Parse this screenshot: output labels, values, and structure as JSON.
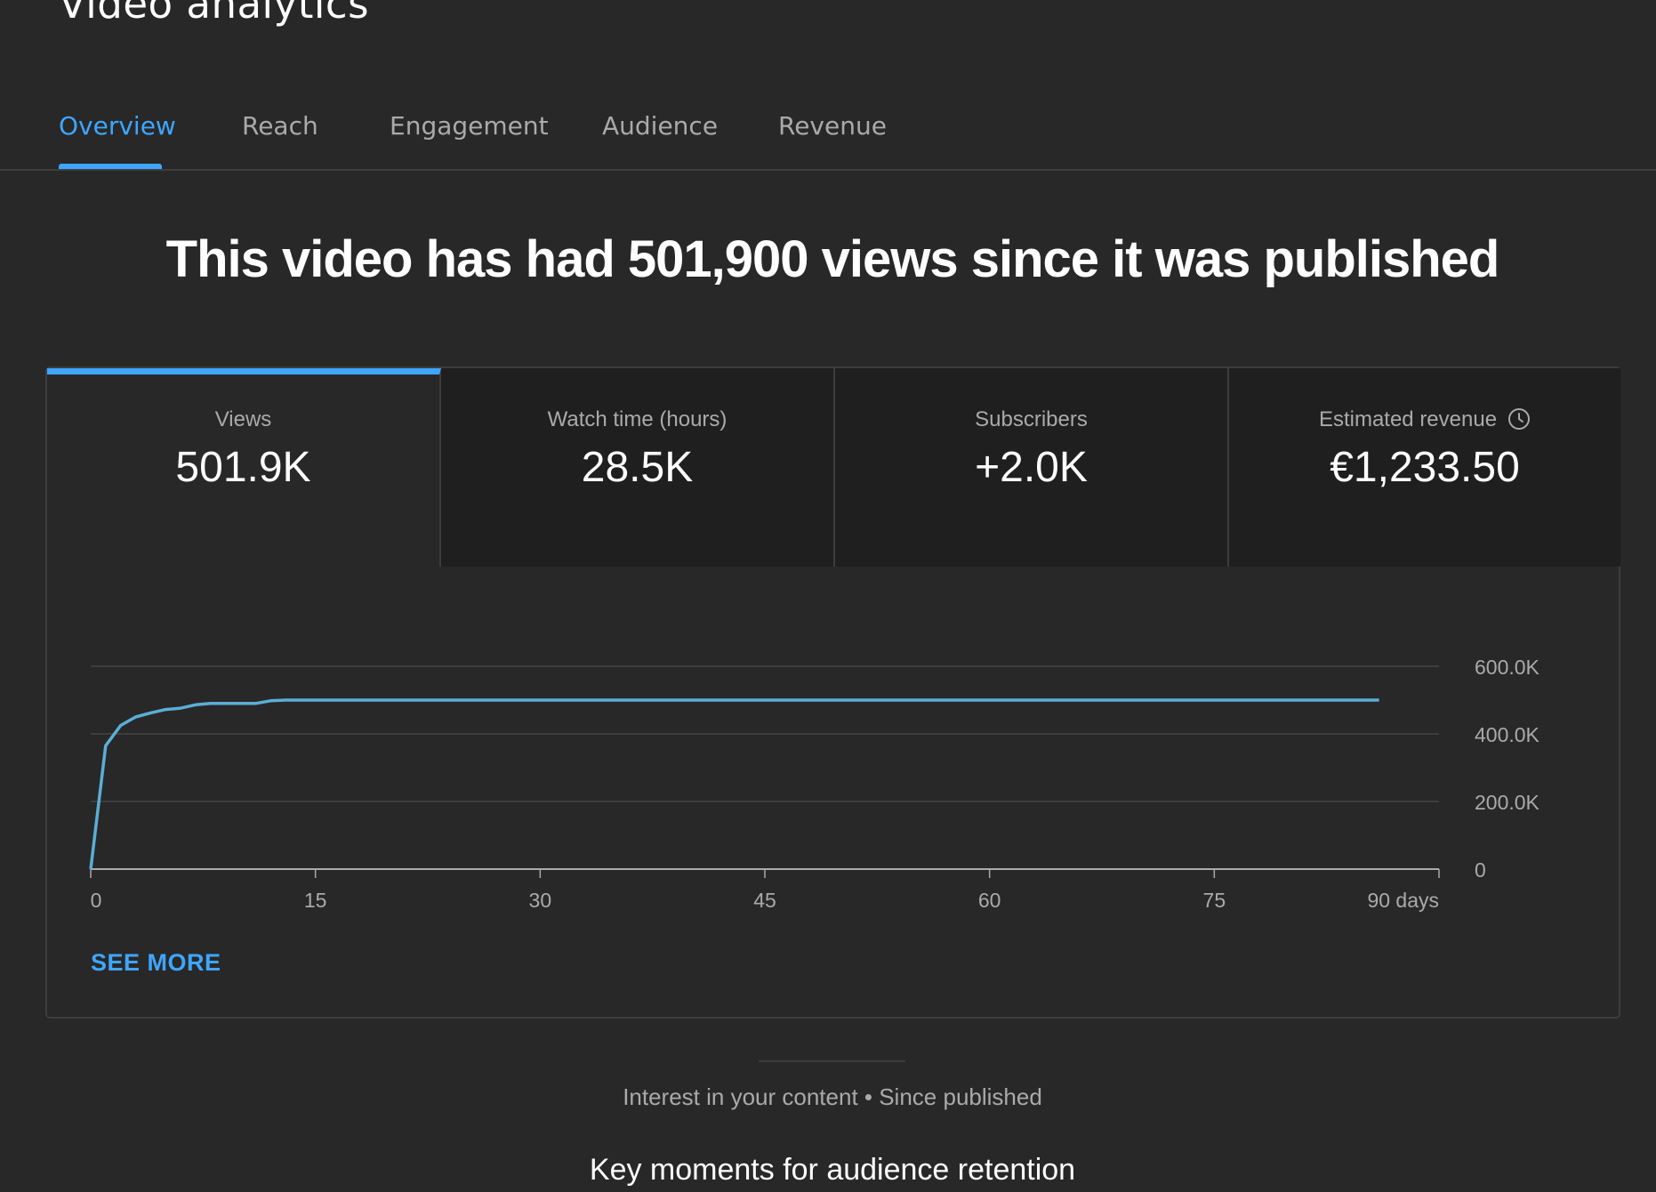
{
  "page": {
    "title": "Video analytics"
  },
  "tabs": [
    {
      "label": "Overview",
      "active": true
    },
    {
      "label": "Reach",
      "active": false
    },
    {
      "label": "Engagement",
      "active": false
    },
    {
      "label": "Audience",
      "active": false
    },
    {
      "label": "Revenue",
      "active": false
    }
  ],
  "headline": "This video has had 501,900 views since it was published",
  "metrics": [
    {
      "label": "Views",
      "value": "501.9K",
      "active": true
    },
    {
      "label": "Watch time (hours)",
      "value": "28.5K",
      "active": false
    },
    {
      "label": "Subscribers",
      "value": "+2.0K",
      "active": false
    },
    {
      "label": "Estimated revenue",
      "value": "€1,233.50",
      "active": false,
      "icon": "clock-icon"
    }
  ],
  "see_more_label": "SEE MORE",
  "interest_text": "Interest in your content • Since published",
  "retention_title": "Key moments for audience retention",
  "colors": {
    "background": "#282828",
    "accent": "#3ea6ff",
    "line": "#5aaed6",
    "muted_text": "#aaaaaa"
  },
  "chart_data": {
    "type": "line",
    "series": [
      {
        "x": [
          0,
          1,
          2,
          3,
          4,
          5,
          6,
          7,
          8,
          9,
          10,
          11,
          12,
          13,
          15,
          30,
          45,
          60,
          75,
          86
        ],
        "values": [
          0,
          365000,
          425000,
          450000,
          462000,
          472000,
          476000,
          486000,
          490000,
          490000,
          490000,
          490000,
          498000,
          500000,
          500000,
          500000,
          500000,
          500000,
          500000,
          500000
        ]
      }
    ],
    "x_ticks": [
      "0",
      "15",
      "30",
      "45",
      "60",
      "75",
      "90 days"
    ],
    "y_ticks": [
      "0",
      "200.0K",
      "400.0K",
      "600.0K"
    ],
    "xlim": [
      0,
      90
    ],
    "ylim": [
      0,
      600000
    ],
    "grid": true,
    "y_axis_side": "right"
  }
}
